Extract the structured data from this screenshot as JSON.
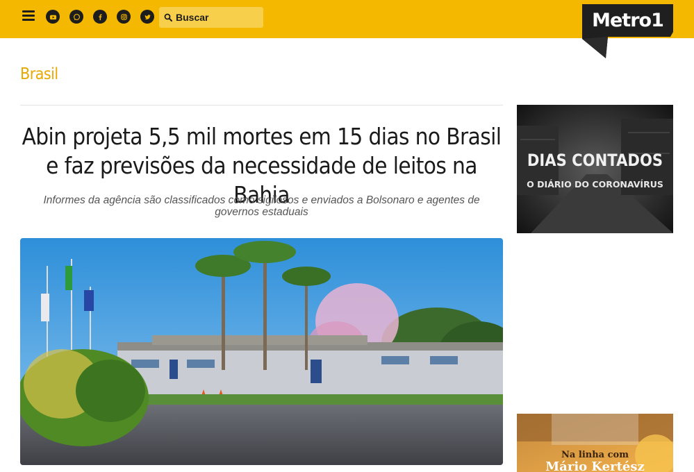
{
  "header": {
    "search_placeholder": "Buscar",
    "logo_text": "Metro1",
    "social": [
      "youtube-icon",
      "whatsapp-icon",
      "facebook-icon",
      "instagram-icon",
      "twitter-icon"
    ],
    "accent_color": "#f5b800"
  },
  "section": {
    "title": "Brasil"
  },
  "article": {
    "headline": "Abin projeta 5,5 mil mortes em 15 dias no Brasil e faz previsões da necessidade de leitos na Bahia",
    "subtitle": "Informes da agência são classificados como sigilosos e enviados a Bolsonaro e agentes de governos estaduais"
  },
  "sidebar": {
    "ad1": {
      "title": "DIAS CONTADOS",
      "subtitle": "O DIÁRIO DO CORONAVÍRUS"
    },
    "ad2": {
      "line1": "Na linha com",
      "line2": "Mário Kertész"
    }
  }
}
